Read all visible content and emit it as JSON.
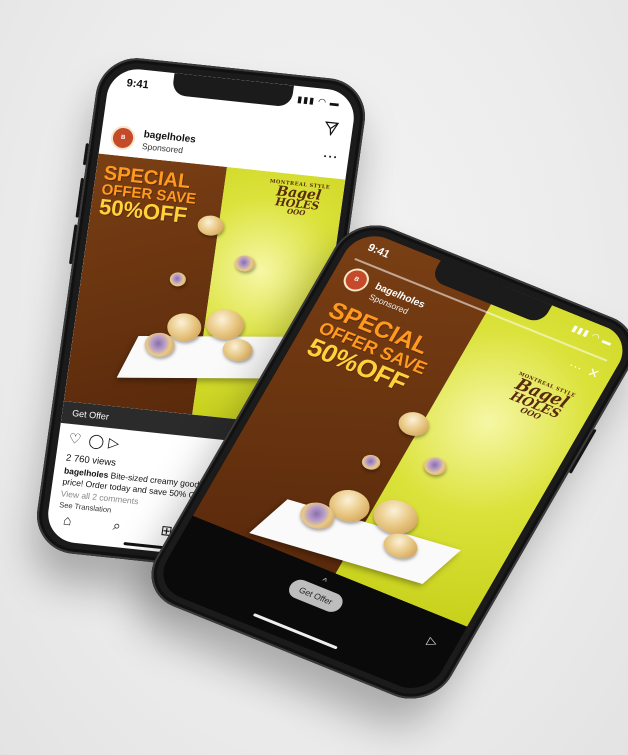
{
  "feed": {
    "status_time": "9:41",
    "status_icons": "▮▮▮ ◠ ▬",
    "dm_icon": "paper-plane-icon",
    "account": "bagelholes",
    "sponsored": "Sponsored",
    "more": "···",
    "ad": {
      "headline_1": "SPECIAL",
      "headline_2": "OFFER SAVE",
      "headline_3": "50%OFF",
      "logo_top": "MONTREAL STYLE",
      "logo_1": "Bagel",
      "logo_2": "HOLES",
      "logo_3": "OOO"
    },
    "cta_label": "Get Offer",
    "cta_arrow": "›",
    "actions": {
      "like": "♡",
      "comment": "◯",
      "share": "▷",
      "save": "⬚"
    },
    "views": "2 760 views",
    "caption_user": "bagelholes",
    "caption_text": " Bite-sized creamy goodness for a fraction of the price! Order today and save 50% OFF your online order!",
    "comments": "View all 2 comments",
    "translation": "See Translation",
    "tabs": {
      "home": "⌂",
      "search": "⌕",
      "add": "⊞",
      "activity": "♡"
    }
  },
  "story": {
    "status_time": "9:41",
    "status_icons": "▮▮▮ ◠ ▬",
    "account": "bagelholes",
    "sponsored": "Sponsored",
    "close": "✕",
    "more": "···",
    "chevron": "^",
    "cta_label": "Get Offer",
    "send_icon": "paper-plane-icon",
    "send": "▷"
  },
  "colors": {
    "brown": "#6b3410",
    "yellow": "#d8df2e",
    "headline_orange": "#ff9a1f",
    "headline_gold": "#ffd23a",
    "cta_bar": "#2b2b2b"
  }
}
